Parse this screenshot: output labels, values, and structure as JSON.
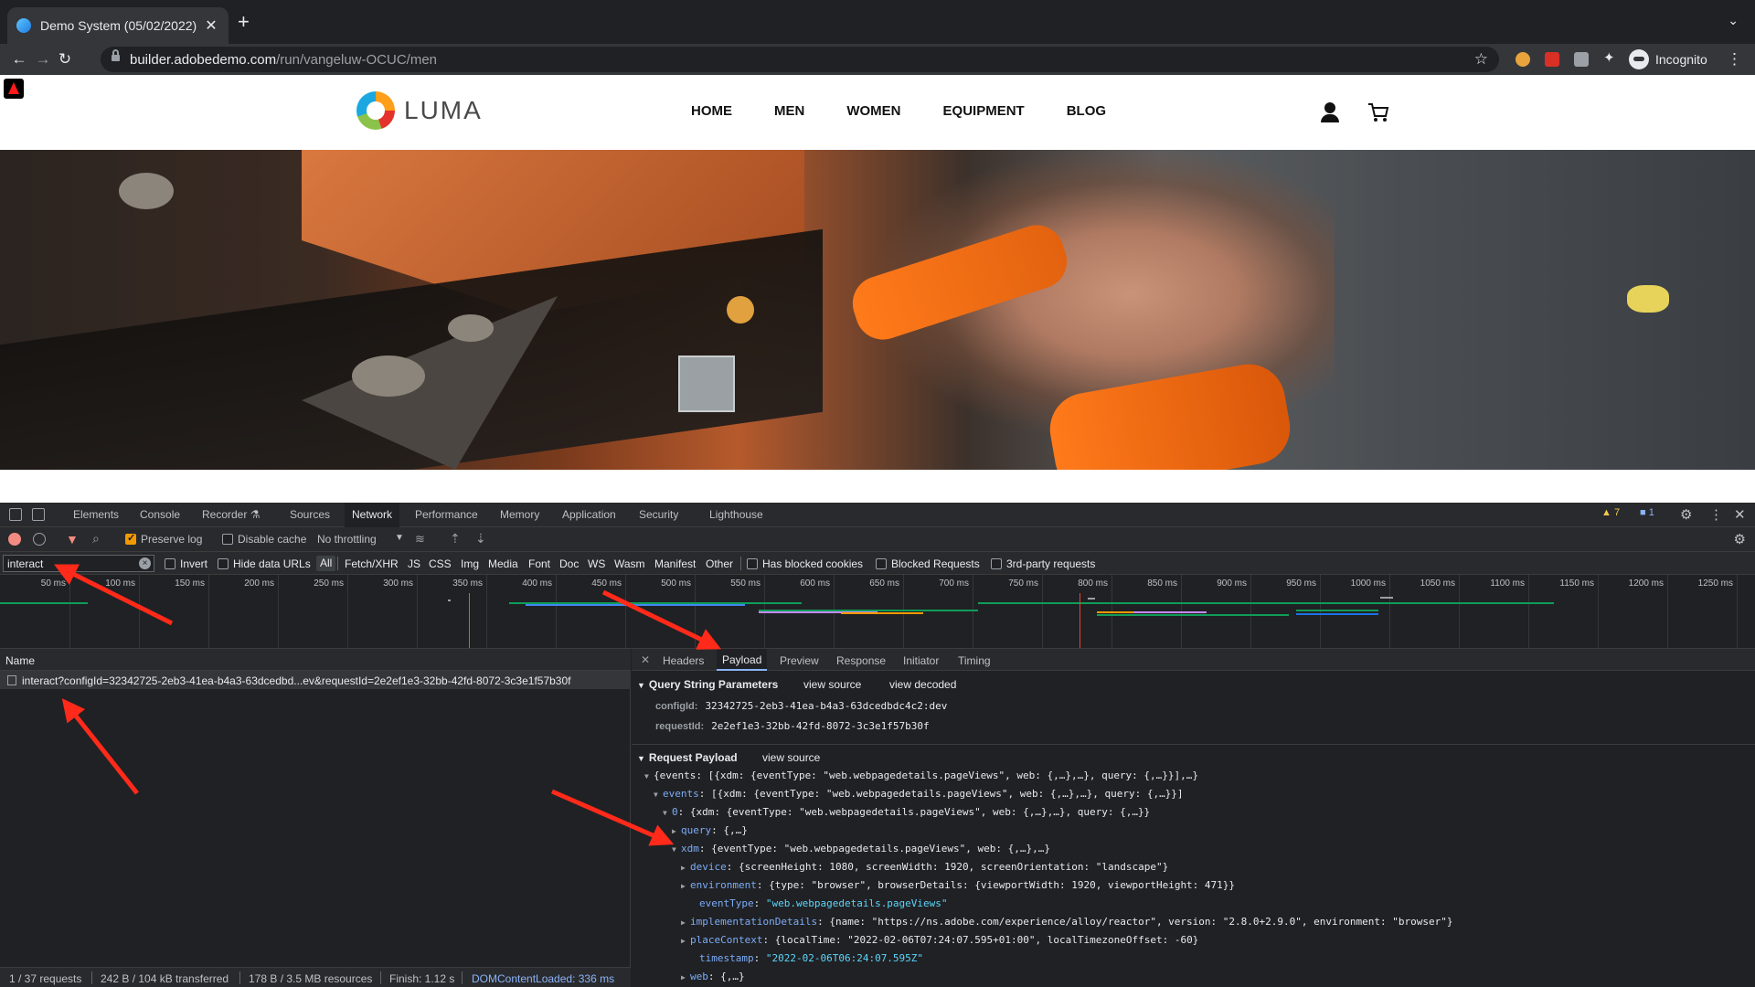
{
  "browser": {
    "tab_title": "Demo System (05/02/2022)",
    "url_host": "builder.adobedemo.com",
    "url_path": "/run/vangeluw-OCUC/men",
    "profile_label": "Incognito"
  },
  "site": {
    "logo_text": "LUMA",
    "nav": [
      "HOME",
      "MEN",
      "WOMEN",
      "EQUIPMENT",
      "BLOG"
    ]
  },
  "devtools": {
    "tabs": [
      "Elements",
      "Console",
      "Recorder ⚗",
      "Sources",
      "Network",
      "Performance",
      "Memory",
      "Application",
      "Security",
      "Lighthouse"
    ],
    "active_tab": "Network",
    "warnings_count": "▲ 7",
    "messages_count": "■ 1",
    "toolbar": {
      "preserve_log": "Preserve log",
      "disable_cache": "Disable cache",
      "throttling": "No throttling"
    },
    "filter": {
      "value": "interact",
      "invert": "Invert",
      "hide_data_urls": "Hide data URLs",
      "types": [
        "All",
        "Fetch/XHR",
        "JS",
        "CSS",
        "Img",
        "Media",
        "Font",
        "Doc",
        "WS",
        "Wasm",
        "Manifest",
        "Other"
      ],
      "has_blocked_cookies": "Has blocked cookies",
      "blocked_requests": "Blocked Requests",
      "third_party": "3rd-party requests"
    },
    "overview_ticks": [
      "50 ms",
      "100 ms",
      "150 ms",
      "200 ms",
      "250 ms",
      "300 ms",
      "350 ms",
      "400 ms",
      "450 ms",
      "500 ms",
      "550 ms",
      "600 ms",
      "650 ms",
      "700 ms",
      "750 ms",
      "800 ms",
      "850 ms",
      "900 ms",
      "950 ms",
      "1000 ms",
      "1050 ms",
      "1100 ms",
      "1150 ms",
      "1200 ms",
      "1250 ms"
    ],
    "name_header": "Name",
    "request_name": "interact?configId=32342725-2eb3-41ea-b4a3-63dcedbd...ev&requestId=2e2ef1e3-32bb-42fd-8072-3c3e1f57b30f",
    "status": {
      "requests": "1 / 37 requests",
      "transferred": "242 B / 104 kB transferred",
      "resources": "178 B / 3.5 MB resources",
      "finish": "Finish: 1.12 s",
      "dcl": "DOMContentLoaded: 336 ms"
    },
    "detail_tabs": [
      "Headers",
      "Payload",
      "Preview",
      "Response",
      "Initiator",
      "Timing"
    ],
    "active_detail_tab": "Payload",
    "query_section": {
      "title": "Query String Parameters",
      "view_source": "view source",
      "view_decoded": "view decoded",
      "params": [
        {
          "key": "configId:",
          "value": "32342725-2eb3-41ea-b4a3-63dcedbdc4c2:dev"
        },
        {
          "key": "requestId:",
          "value": "2e2ef1e3-32bb-42fd-8072-3c3e1f57b30f"
        }
      ]
    },
    "payload_section": {
      "title": "Request Payload",
      "view_source": "view source",
      "lines": [
        {
          "arrow": "▼",
          "key": "",
          "text": "{events: [{xdm: {eventType: \"web.webpagedetails.pageViews\", web: {,…},…}, query: {,…}}],…}",
          "str": ""
        },
        {
          "arrow": "▼",
          "key": "events",
          "text": ": [{xdm: {eventType: \"web.webpagedetails.pageViews\", web: {,…},…}, query: {,…}}]",
          "str": ""
        },
        {
          "arrow": "▼",
          "key": "0",
          "text": ": {xdm: {eventType: \"web.webpagedetails.pageViews\", web: {,…},…}, query: {,…}}",
          "str": ""
        },
        {
          "arrow": "▶",
          "key": "query",
          "text": ": {,…}",
          "str": ""
        },
        {
          "arrow": "▼",
          "key": "xdm",
          "text": ": {eventType: \"web.webpagedetails.pageViews\", web: {,…},…}",
          "str": ""
        },
        {
          "arrow": "▶",
          "key": "device",
          "text": ": {screenHeight: 1080, screenWidth: 1920, screenOrientation: \"landscape\"}",
          "str": ""
        },
        {
          "arrow": "▶",
          "key": "environment",
          "text": ": {type: \"browser\", browserDetails: {viewportWidth: 1920, viewportHeight: 471}}",
          "str": ""
        },
        {
          "arrow": "",
          "key": "eventType",
          "text": ": ",
          "str": "\"web.webpagedetails.pageViews\""
        },
        {
          "arrow": "▶",
          "key": "implementationDetails",
          "text": ": {name: \"https://ns.adobe.com/experience/alloy/reactor\", version: \"2.8.0+2.9.0\", environment: \"browser\"}",
          "str": ""
        },
        {
          "arrow": "▶",
          "key": "placeContext",
          "text": ": {localTime: \"2022-02-06T07:24:07.595+01:00\", localTimezoneOffset: -60}",
          "str": ""
        },
        {
          "arrow": "",
          "key": "timestamp",
          "text": ": ",
          "str": "\"2022-02-06T06:24:07.595Z\""
        },
        {
          "arrow": "▶",
          "key": "web",
          "text": ": {,…}",
          "str": ""
        }
      ]
    }
  }
}
